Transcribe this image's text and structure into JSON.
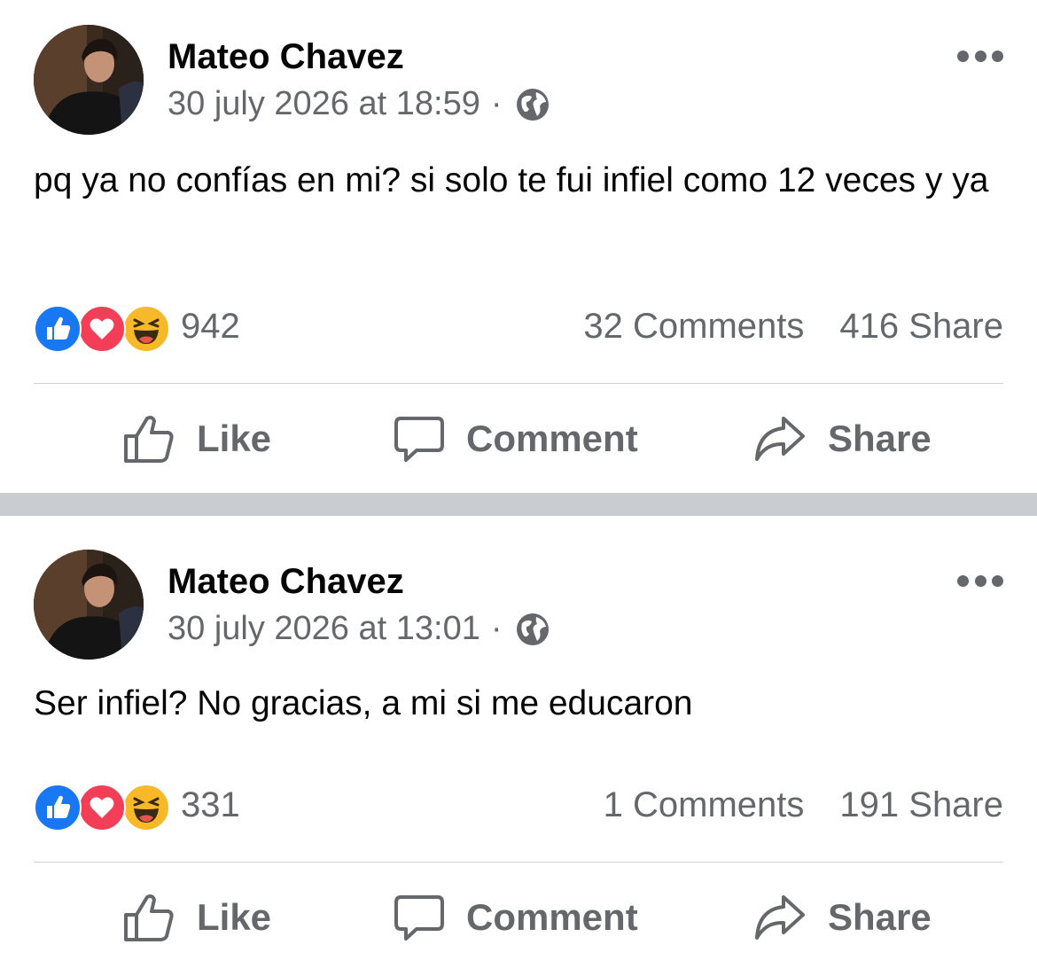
{
  "posts": [
    {
      "author": "Mateo Chavez",
      "timestamp": "30 july 2026 at 18:59",
      "separator": "·",
      "audience_icon": "globe-icon",
      "text": "pq ya no confías en mi? si solo te fui infiel como 12 veces y ya",
      "reactions": [
        "like",
        "love",
        "haha"
      ],
      "reaction_count": "942",
      "comments": "32 Comments",
      "shares": "416 Share",
      "actions": {
        "like": "Like",
        "comment": "Comment",
        "share": "Share"
      }
    },
    {
      "author": "Mateo Chavez",
      "timestamp": "30 july 2026 at 13:01",
      "separator": "·",
      "audience_icon": "globe-icon",
      "text": "Ser infiel? No gracias, a mi si me educaron",
      "reactions": [
        "like",
        "love",
        "haha"
      ],
      "reaction_count": "331",
      "comments": "1 Comments",
      "shares": "191 Share",
      "actions": {
        "like": "Like",
        "comment": "Comment",
        "share": "Share"
      }
    }
  ],
  "colors": {
    "text_primary": "#050505",
    "text_secondary": "#65676b",
    "like_blue": "#1877f2",
    "love_red": "#f33e58",
    "haha_yellow": "#f7b928",
    "separator_gray": "#c9ccd1"
  }
}
